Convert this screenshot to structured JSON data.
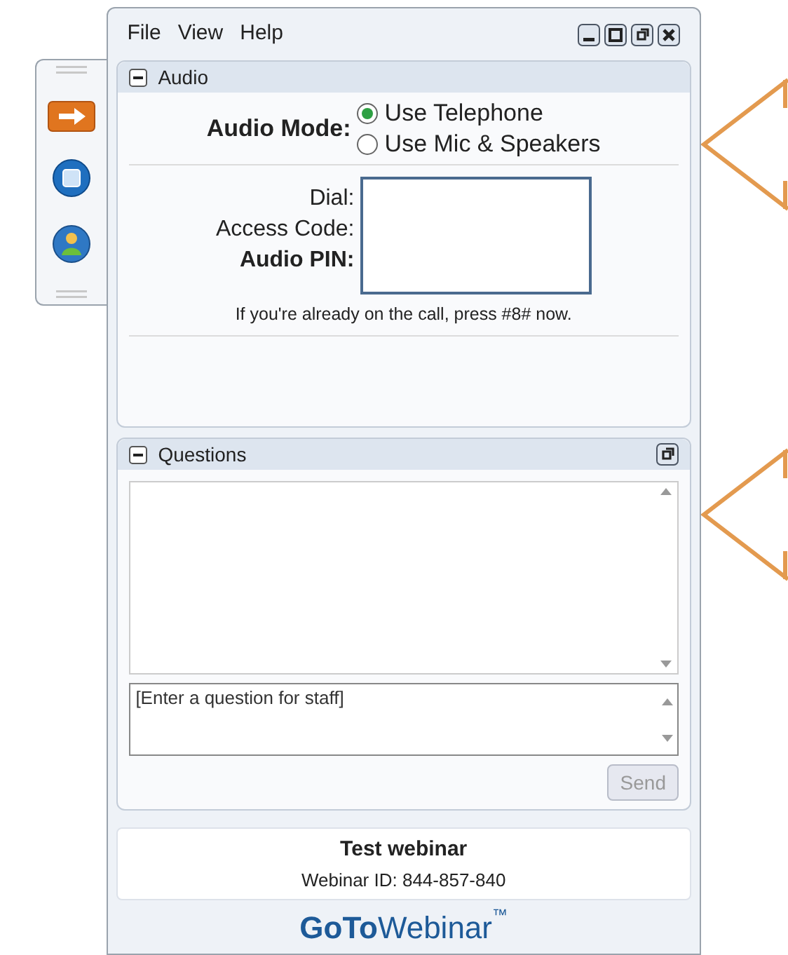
{
  "menu": [
    "File",
    "View",
    "Help"
  ],
  "audio": {
    "title": "Audio",
    "expanded": true,
    "mode_label": "Audio Mode:",
    "modes": [
      {
        "label": "Use Telephone",
        "selected": true
      },
      {
        "label": "Use Mic & Speakers",
        "selected": false
      }
    ],
    "fields": [
      {
        "label": "Dial:",
        "bold": false
      },
      {
        "label": "Access Code:",
        "bold": false
      },
      {
        "label": "Audio PIN:",
        "bold": true
      }
    ],
    "note": "If you're already on the call, press #8# now."
  },
  "questions": {
    "title": "Questions",
    "expanded": true,
    "input": {
      "placeholder": "[Enter a question for staff]"
    },
    "send": {
      "label": "Send",
      "disabled": true
    }
  },
  "webinar": {
    "title": "Test webinar",
    "id": "Webinar ID: 844-857-840"
  },
  "brand": {
    "bold": "GoTo",
    "light": "Webinar",
    "mark": "™"
  }
}
